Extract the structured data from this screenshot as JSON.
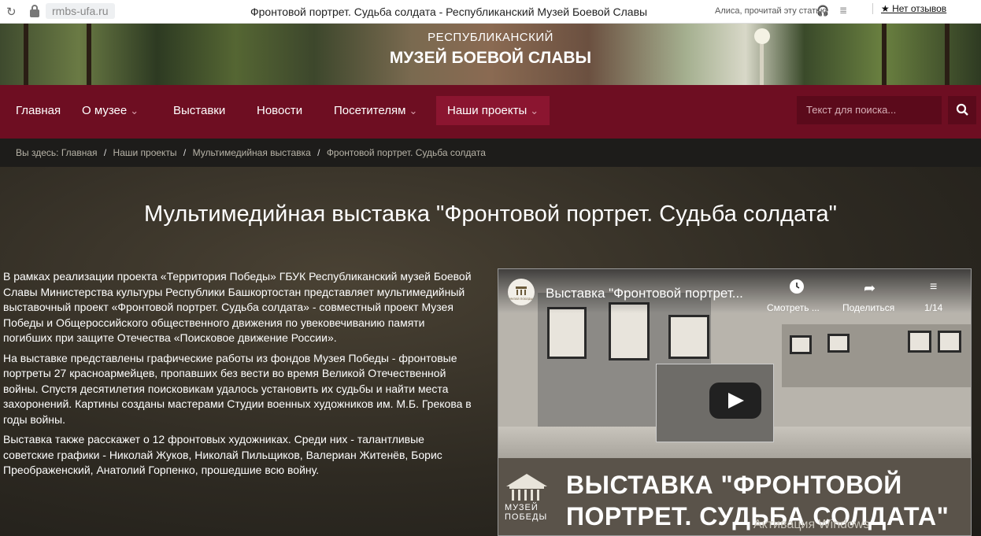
{
  "browser": {
    "reload_icon": "reload-icon",
    "url": "rmbs-ufa.ru",
    "tab_title": "Фронтовой портрет. Судьба солдата - Республиканский Музей Боевой Славы",
    "alice_prompt": "Алиса, прочитай эту статью",
    "reviews": "★ Нет отзывов"
  },
  "header": {
    "line1": "РЕСПУБЛИКАНСКИЙ",
    "line2": "МУЗЕЙ БОЕВОЙ СЛАВЫ"
  },
  "nav": {
    "items": [
      {
        "label": "Главная",
        "dropdown": false
      },
      {
        "label": "О музее",
        "dropdown": true
      },
      {
        "label": "Выставки",
        "dropdown": false
      },
      {
        "label": "Новости",
        "dropdown": false
      },
      {
        "label": "Посетителям",
        "dropdown": true
      },
      {
        "label": "Наши проекты",
        "dropdown": true,
        "active": true
      }
    ],
    "caret": "⌄",
    "search_placeholder": "Текст для поиска..."
  },
  "breadcrumb": {
    "prefix": "Вы здесь:",
    "items": [
      "Главная",
      "Наши проекты",
      "Мультимедийная выставка",
      "Фронтовой портрет. Судьба солдата"
    ],
    "separator": "/"
  },
  "page": {
    "title": "Мультимедийная выставка \"Фронтовой портрет. Судьба солдата\"",
    "paragraphs": [
      "В рамках реализации проекта «Территория Победы» ГБУК Республиканский музей Боевой Славы Министерства культуры Республики Башкортостан представляет мультимедийный выставочный проект «Фронтовой портрет. Судьба солдата» - совместный проект Музея Победы и Общероссийского общественного движения по увековечиванию памяти погибших при защите Отечества «Поисковое движение России».",
      "На выставке представлены графические работы из фондов Музея Победы - фронтовые портреты 27 красноармейцев, пропавших без вести во время Великой Отечественной войны. Спустя десятилетия поисковикам удалось установить их судьбы и найти места захоронений. Картины созданы мастерами Студии военных художников им. М.Б. Грекова в годы войны.",
      "Выставка также расскажет о 12 фронтовых художниках. Среди них - талантливые советские графики - Николай Жуков, Николай Пильщиков, Валериан Житенёв, Борис Преображенский, Анатолий Горпенко, прошедшие всю войну."
    ]
  },
  "video": {
    "title": "Выставка \"Фронтовой портрет...",
    "watch_later": "Смотреть ...",
    "share": "Поделиться",
    "playlist_count": "1/14",
    "banner_title": "ВЫСТАВКА \"ФРОНТОВОЙ ПОРТРЕТ. СУДЬБА СОЛДАТА\"",
    "logo_text_1": "МУЗЕЙ",
    "logo_text_2": "ПОБЕДЫ",
    "channel_logo_text": "МУЗЕЙ ПОБЕДЫ"
  },
  "overlay": {
    "windows_activation": "Активация Windows"
  },
  "colors": {
    "nav_bg": "#6e0e22",
    "nav_active": "#8b1530",
    "breadcrumb_bg": "#1d1c1a"
  }
}
